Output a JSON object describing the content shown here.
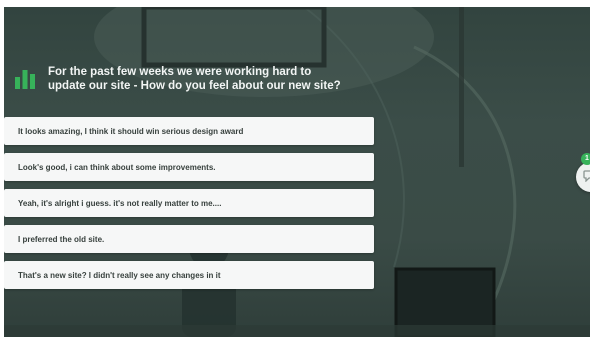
{
  "poll": {
    "icon": "bar-chart-icon",
    "question": "For the past few weeks we were working hard to update our site - How do you feel about our new site?",
    "options": [
      "It looks amazing, I think it should win serious design award",
      "Look's good, i can think about some improvements.",
      "Yeah, it's alright i guess. it's not really matter to me....",
      "I preferred the old site.",
      "That's a new site? I didn't  really see any changes in it"
    ]
  },
  "chat": {
    "icon": "chat-bubble-icon",
    "badge_count": "1"
  },
  "colors": {
    "accent_green": "#37b25a",
    "option_bg": "#f6f7f7",
    "option_text": "#37403d",
    "question_text": "#f2f5f4"
  }
}
